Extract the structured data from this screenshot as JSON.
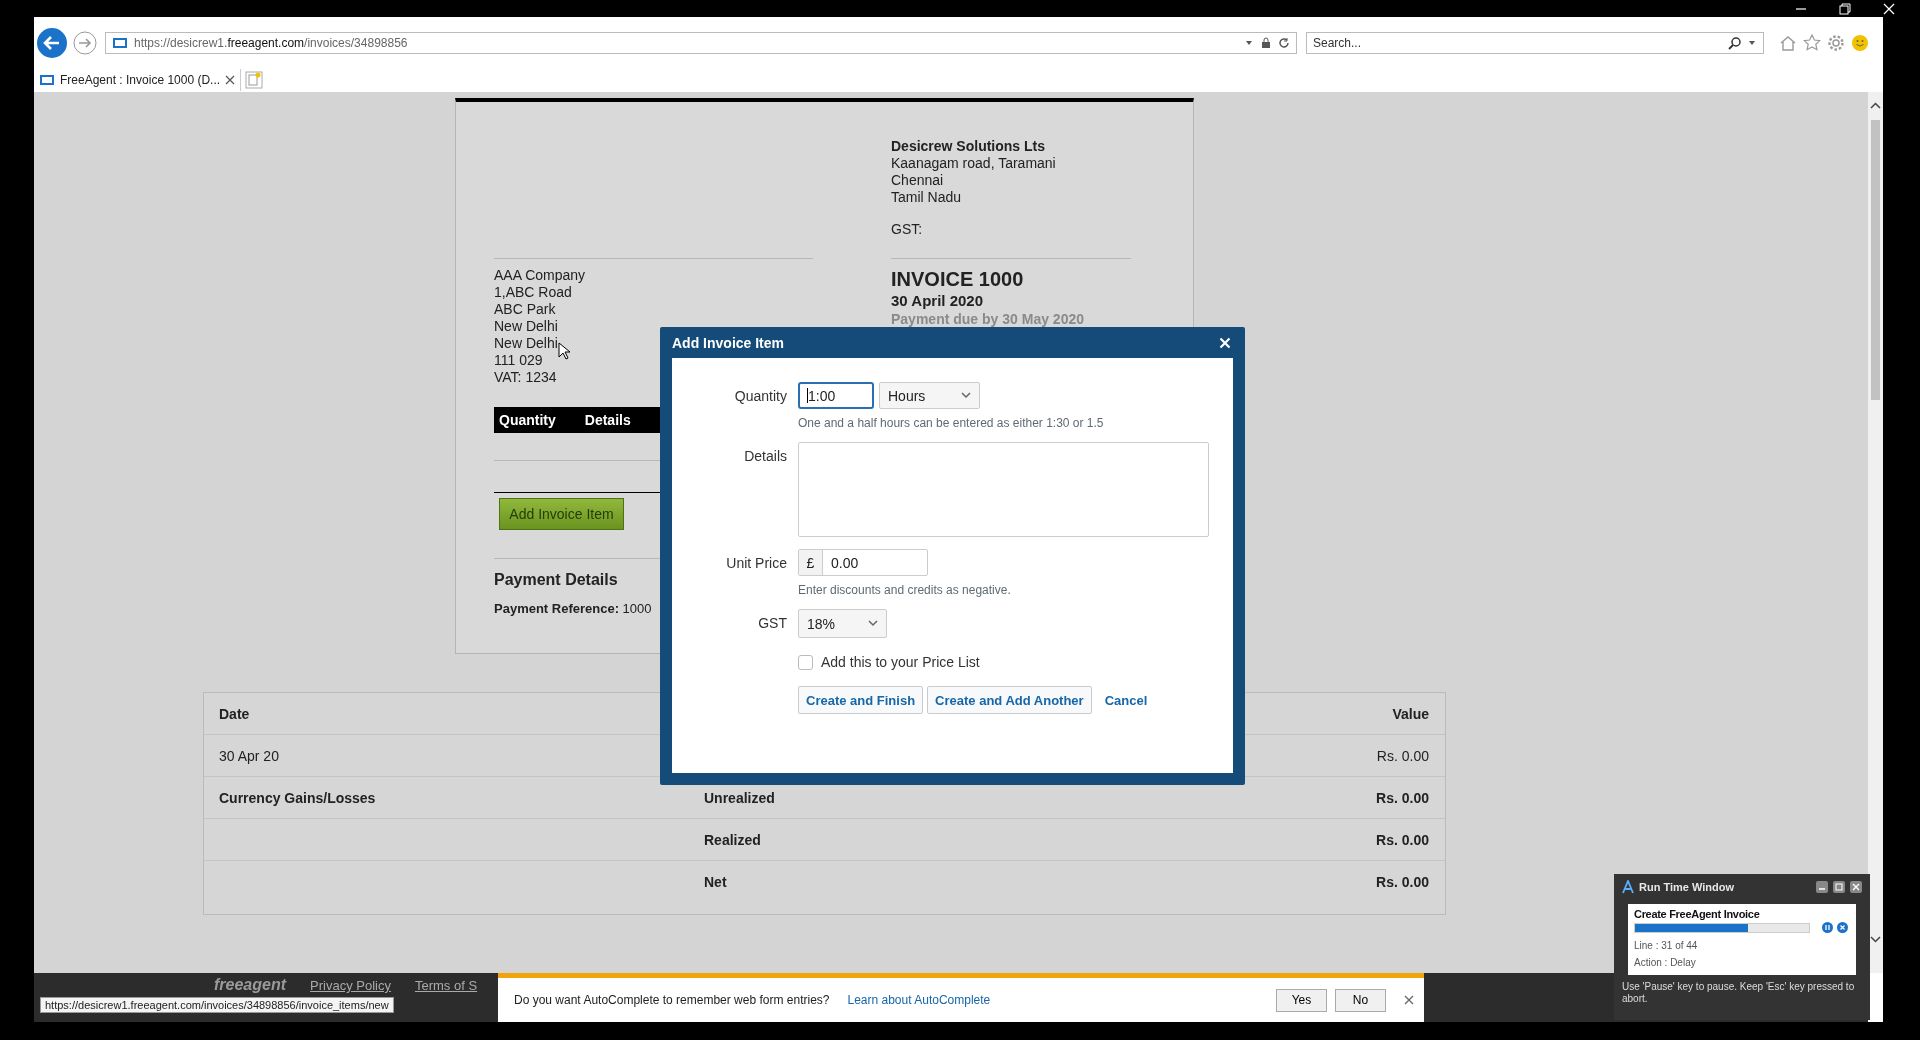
{
  "browser": {
    "url": "https://desicrew1.**freeagent.com**/invoices/34898856",
    "search_placeholder": "Search...",
    "tab_title": "FreeAgent : Invoice 1000 (D..."
  },
  "invoice": {
    "company_name": "Desicrew Solutions Lts",
    "company_lines": [
      "Kaanagam road, Taramani",
      "Chennai",
      "Tamil Nadu"
    ],
    "gst": "GST:",
    "client_lines": [
      "AAA Company",
      "1,ABC Road",
      "ABC Park",
      "New Delhi",
      "New Delhi",
      "111 029",
      "VAT: 1234"
    ],
    "title": "INVOICE 1000",
    "date": "30 April 2020",
    "due": "Payment due by 30 May 2020",
    "item_columns": [
      "Quantity",
      "Details"
    ],
    "add_button": "Add Invoice Item",
    "payment_heading": "Payment Details",
    "payment_reference": "**Payment Reference:** 1000"
  },
  "summary_table": {
    "columns": [
      "Date",
      "Value"
    ],
    "rows": [
      {
        "bold": false,
        "first": "30 Apr 20",
        "value": "Rs. 0.00"
      },
      {
        "bold": true,
        "first": "Currency Gains/Losses",
        "middle": "Unrealized",
        "value": "Rs. 0.00"
      },
      {
        "bold": true,
        "middle": "Realized",
        "value": "Rs. 0.00"
      },
      {
        "bold": true,
        "middle": "Net",
        "value": "Rs. 0.00"
      }
    ]
  },
  "modal": {
    "title": "Add Invoice Item",
    "fields": [
      {
        "kind": "quantity",
        "label": "Quantity",
        "value": "1:00",
        "focused": true,
        "unit": "Hours",
        "hint": "One and a half hours can be entered as either 1:30 or 1.5"
      },
      {
        "kind": "textarea",
        "label": "Details"
      },
      {
        "kind": "price",
        "label": "Unit Price",
        "currency": "£",
        "value": "0.00",
        "hint": "Enter discounts and credits as negative."
      },
      {
        "kind": "select",
        "label": "GST",
        "value": "18%"
      }
    ],
    "price_list": {
      "label": "Add this to your Price List",
      "checked": false
    },
    "buttons": [
      {
        "kind": "button",
        "label": "Create and Finish"
      },
      {
        "kind": "button",
        "label": "Create and Add Another"
      },
      {
        "kind": "link",
        "label": "Cancel"
      }
    ]
  },
  "footer": {
    "logo": "freeagent",
    "links": [
      "Privacy Policy",
      "Terms of S"
    ]
  },
  "status_url": "https://desicrew1.freeagent.com/invoices/34898856/invoice_items/new",
  "autocomplete": {
    "message": "Do you want AutoComplete to remember web form entries?",
    "link": "Learn about AutoComplete",
    "buttons": [
      "Yes",
      "No"
    ]
  },
  "runtime": {
    "title": "Run Time Window",
    "task": "Create FreeAgent Invoice",
    "level": 0.65,
    "line": "Line : 31 of 44",
    "action": "Action : Delay",
    "hint": "Use 'Pause' key to pause. Keep 'Esc' key pressed to abort."
  }
}
